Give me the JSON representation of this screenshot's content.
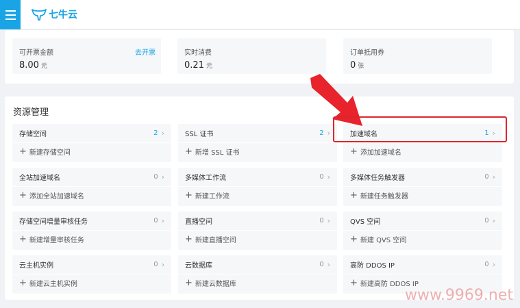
{
  "header": {
    "brand": "七牛云",
    "colors": {
      "accent": "#19a4e6",
      "highlight": "#d9262f"
    }
  },
  "stats": [
    {
      "label": "可开票金额",
      "link": "去开票",
      "value": "8.00",
      "unit": "元"
    },
    {
      "label": "实时消费",
      "link": "",
      "value": "0.21",
      "unit": "元"
    },
    {
      "label": "订单抵用券",
      "link": "",
      "value": "0",
      "unit": "张"
    }
  ],
  "resources": {
    "title": "资源管理",
    "items": [
      {
        "name": "存储空间",
        "count": "2",
        "add": "新建存储空间"
      },
      {
        "name": "SSL 证书",
        "count": "2",
        "add": "新增 SSL 证书"
      },
      {
        "name": "加速域名",
        "count": "1",
        "add": "添加加速域名"
      },
      {
        "name": "全站加速域名",
        "count": "0",
        "add": "添加全站加速域名"
      },
      {
        "name": "多媒体工作流",
        "count": "0",
        "add": "新建工作流"
      },
      {
        "name": "多媒体任务触发器",
        "count": "0",
        "add": "新建任务触发器"
      },
      {
        "name": "存储空间增量审核任务",
        "count": "0",
        "add": "新建增量审核任务"
      },
      {
        "name": "直播空间",
        "count": "0",
        "add": "新建直播空间"
      },
      {
        "name": "QVS 空间",
        "count": "0",
        "add": "新建 QVS 空间"
      },
      {
        "name": "云主机实例",
        "count": "0",
        "add": "新建云主机实例"
      },
      {
        "name": "云数据库",
        "count": "0",
        "add": "新建云数据库"
      },
      {
        "name": "高防 DDOS IP",
        "count": "0",
        "add": "新建高防 DDOS IP"
      }
    ]
  },
  "watermark": "www.9969.net"
}
